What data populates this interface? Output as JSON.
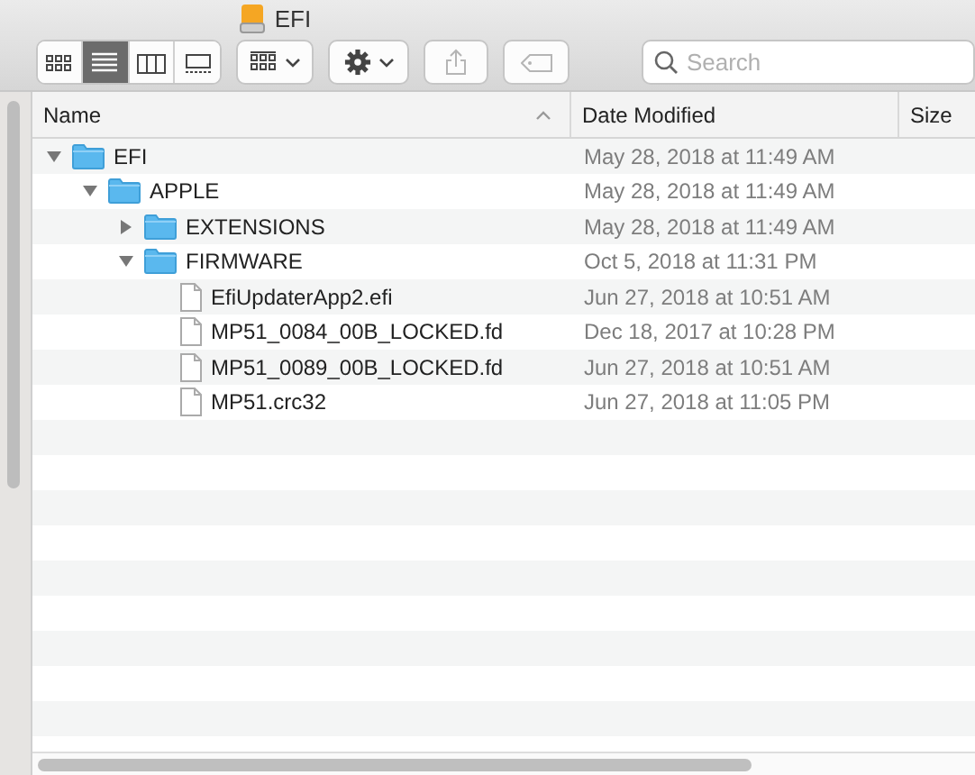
{
  "window": {
    "title": "EFI"
  },
  "view_buttons": [
    {
      "kind": "icons",
      "selected": false
    },
    {
      "kind": "list",
      "selected": true
    },
    {
      "kind": "columns",
      "selected": false
    },
    {
      "kind": "gallery",
      "selected": false
    }
  ],
  "search": {
    "placeholder": "Search"
  },
  "columns": [
    {
      "label": "Name",
      "sorted": true
    },
    {
      "label": "Date Modified",
      "sorted": false
    },
    {
      "label": "Size",
      "sorted": false
    }
  ],
  "files": [
    {
      "name": "EFI",
      "kind": "folder",
      "expanded": true,
      "date": "May 28, 2018 at 11:49 AM",
      "children": [
        {
          "name": "APPLE",
          "kind": "folder",
          "expanded": true,
          "date": "May 28, 2018 at 11:49 AM",
          "children": [
            {
              "name": "EXTENSIONS",
              "kind": "folder",
              "expanded": false,
              "date": "May 28, 2018 at 11:49 AM"
            },
            {
              "name": "FIRMWARE",
              "kind": "folder",
              "expanded": true,
              "date": "Oct 5, 2018 at 11:31 PM",
              "children": [
                {
                  "name": "EfiUpdaterApp2.efi",
                  "kind": "file",
                  "date": "Jun 27, 2018 at 10:51 AM"
                },
                {
                  "name": "MP51_0084_00B_LOCKED.fd",
                  "kind": "file",
                  "date": "Dec 18, 2017 at 10:28 PM"
                },
                {
                  "name": "MP51_0089_00B_LOCKED.fd",
                  "kind": "file",
                  "date": "Jun 27, 2018 at 10:51 AM"
                },
                {
                  "name": "MP51.crc32",
                  "kind": "file",
                  "date": "Jun 27, 2018 at 11:05 PM"
                }
              ]
            }
          ]
        }
      ]
    }
  ]
}
